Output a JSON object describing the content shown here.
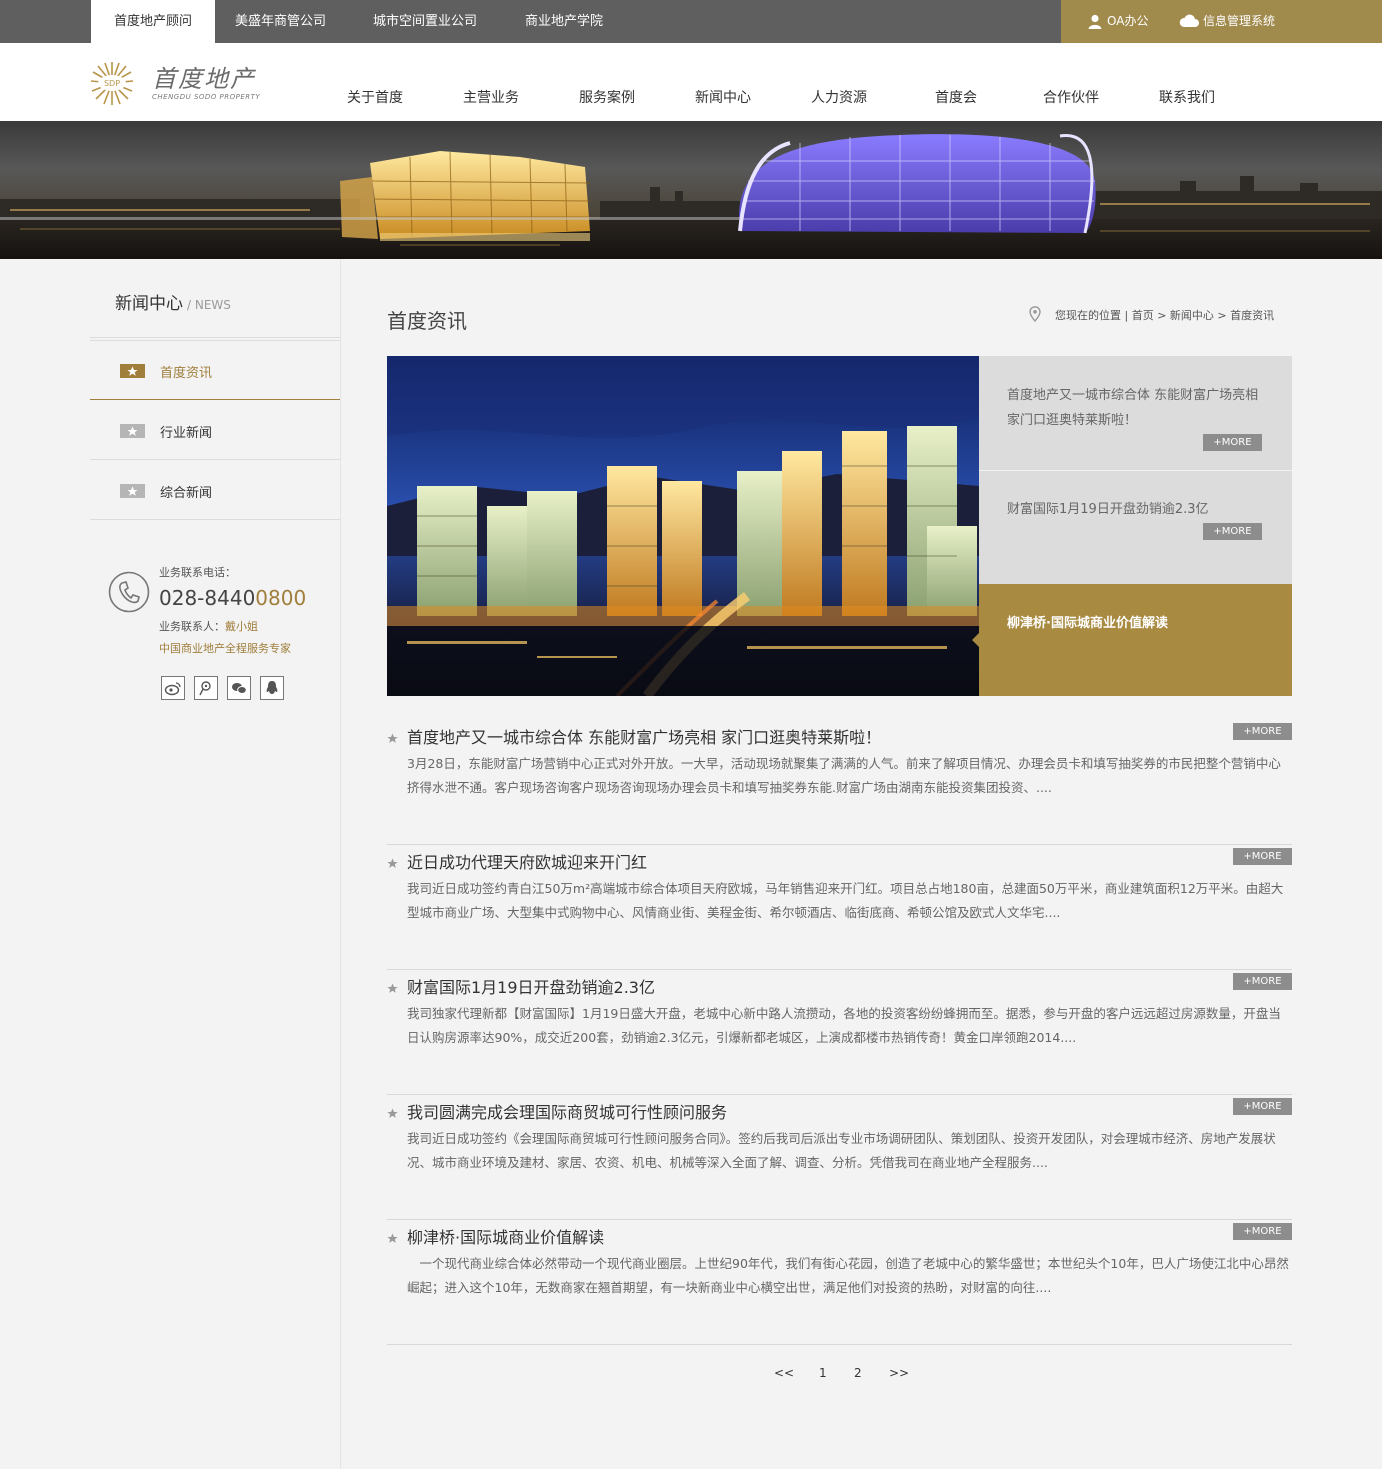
{
  "topbar": {
    "tabs": [
      "首度地产顾问",
      "美盛年商管公司",
      "城市空间置业公司",
      "商业地产学院"
    ],
    "oa_label": "OA办公",
    "info_label": "信息管理系统"
  },
  "header": {
    "logo_abbr": "SDP",
    "logo_cn": "首度地产",
    "logo_en": "CHENGDU SODO PROPERTY",
    "nav": [
      "关于首度",
      "主营业务",
      "服务案例",
      "新闻中心",
      "人力资源",
      "首度会",
      "合作伙伴",
      "联系我们"
    ]
  },
  "sidebar": {
    "title": "新闻中心",
    "title_en": "/ NEWS",
    "items": [
      "首度资讯",
      "行业新闻",
      "综合新闻"
    ],
    "contact_label": "业务联系电话：",
    "phone_a": "028-8440",
    "phone_b": "0800",
    "person_label": "业务联系人：",
    "person_name": "戴小姐",
    "slogan": "中国商业地产全程服务专家",
    "social": [
      "weibo-icon",
      "tencent-weibo-icon",
      "wechat-icon",
      "qq-icon"
    ]
  },
  "main": {
    "title": "首度资讯",
    "crumb": "您现在的位置 | 首页 > 新闻中心 > 首度资讯",
    "featured": [
      {
        "title": "首度地产又一城市综合体 东能财富广场亮相 家门口逛奥特莱斯啦！",
        "more": "+MORE"
      },
      {
        "title": "财富国际1月19日开盘劲销逾2.3亿",
        "more": "+MORE"
      },
      {
        "title": "柳津桥·国际城商业价值解读"
      }
    ],
    "news": [
      {
        "title": "首度地产又一城市综合体 东能财富广场亮相 家门口逛奥特莱斯啦！",
        "desc": "3月28日，东能财富广场营销中心正式对外开放。一大早，活动现场就聚集了满满的人气。前来了解项目情况、办理会员卡和填写抽奖券的市民把整个营销中心挤得水泄不通。客户现场咨询客户现场咨询现场办理会员卡和填写抽奖券东能.财富广场由湖南东能投资集团投资、....",
        "more": "+MORE"
      },
      {
        "title": "近日成功代理天府欧城迎来开门红",
        "desc": "我司近日成功签约青白江50万m²高端城市综合体项目天府欧城，马年销售迎来开门红。项目总占地180亩，总建面50万平米，商业建筑面积12万平米。由超大型城市商业广场、大型集中式购物中心、风情商业街、美程金街、希尔顿酒店、临街底商、希顿公馆及欧式人文华宅....",
        "more": "+MORE"
      },
      {
        "title": "财富国际1月19日开盘劲销逾2.3亿",
        "desc": "我司独家代理新都【财富国际】1月19日盛大开盘，老城中心新中路人流攒动，各地的投资客纷纷蜂拥而至。据悉，参与开盘的客户远远超过房源数量，开盘当日认购房源率达90%，成交近200套，劲销逾2.3亿元，引爆新都老城区，上演成都楼市热销传奇！黄金口岸领跑2014....",
        "more": "+MORE"
      },
      {
        "title": "我司圆满完成会理国际商贸城可行性顾问服务",
        "desc": "我司近日成功签约《会理国际商贸城可行性顾问服务合同》。签约后我司后派出专业市场调研团队、策划团队、投资开发团队，对会理城市经济、房地产发展状况、城市商业环境及建材、家居、农资、机电、机械等深入全面了解、调查、分析。凭借我司在商业地产全程服务....",
        "more": "+MORE"
      },
      {
        "title": "柳津桥·国际城商业价值解读",
        "desc": "　一个现代商业综合体必然带动一个现代商业圈层。上世纪90年代，我们有街心花园，创造了老城中心的繁华盛世；本世纪头个10年，巴人广场使江北中心昂然崛起；进入这个10年，无数商家在翘首期望，有一块新商业中心横空出世，满足他们对投资的热盼，对财富的向往....",
        "more": "+MORE"
      }
    ],
    "pager": [
      "<<",
      "1",
      "2",
      ">>"
    ]
  }
}
